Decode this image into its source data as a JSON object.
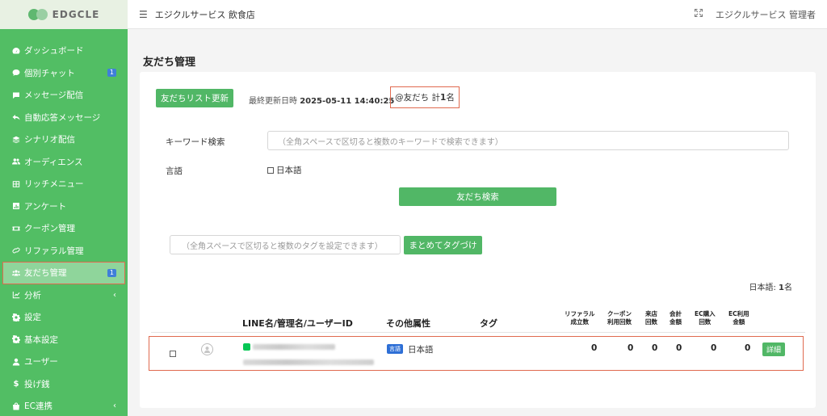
{
  "brand": {
    "name": "EDGCLE"
  },
  "header": {
    "title": "エジクルサービス 飲食店",
    "user": "エジクルサービス 管理者"
  },
  "sidebar": {
    "items": [
      {
        "label": "ダッシュボード",
        "icon": "dashboard-icon"
      },
      {
        "label": "個別チャット",
        "icon": "chat-icon",
        "badge": "1"
      },
      {
        "label": "メッセージ配信",
        "icon": "message-icon"
      },
      {
        "label": "自動応答メッセージ",
        "icon": "reply-icon"
      },
      {
        "label": "シナリオ配信",
        "icon": "layers-icon"
      },
      {
        "label": "オーディエンス",
        "icon": "users-icon"
      },
      {
        "label": "リッチメニュー",
        "icon": "grid-icon"
      },
      {
        "label": "アンケート",
        "icon": "survey-icon"
      },
      {
        "label": "クーポン管理",
        "icon": "ticket-icon"
      },
      {
        "label": "リファラル管理",
        "icon": "link-icon"
      },
      {
        "label": "友だち管理",
        "icon": "friends-icon",
        "badge": "1",
        "active": true
      },
      {
        "label": "分析",
        "icon": "chart-icon",
        "chevron": "‹"
      },
      {
        "label": "設定",
        "icon": "gear-icon"
      },
      {
        "label": "基本設定",
        "icon": "gear-icon"
      },
      {
        "label": "ユーザー",
        "icon": "user-icon"
      },
      {
        "label": "投げ銭",
        "icon": "dollar-icon"
      },
      {
        "label": "EC連携",
        "icon": "bag-icon",
        "chevron": "‹"
      }
    ]
  },
  "page": {
    "title": "友だち管理",
    "refresh_button": "友だちリスト更新",
    "last_updated_label": "最終更新日時",
    "last_updated_value": "2025-05-11 14:40:25",
    "friend_count_prefix": "@友だち 計 ",
    "friend_count_value": "1",
    "friend_count_suffix": "名",
    "keyword_label": "キーワード検索",
    "keyword_placeholder": "（全角スペースで区切ると複数のキーワードで検索できます）",
    "language_label": "言語",
    "language_option": "日本語",
    "search_button": "友だち検索",
    "tag_placeholder": "（全角スペースで区切ると複数のタグを設定できます）",
    "tag_button": "まとめてタグづけ",
    "language_stat_prefix": "日本語: ",
    "language_stat_value": "1",
    "language_stat_suffix": "名"
  },
  "table": {
    "headers": {
      "name": "LINE名/管理名/ユーザーID",
      "attrs": "その他属性",
      "tag": "タグ",
      "referral": [
        "リファラル",
        "成立数"
      ],
      "coupon": [
        "クーポン",
        "利用回数"
      ],
      "visits": [
        "来店",
        "回数"
      ],
      "amount": [
        "会計",
        "金額"
      ],
      "ec_count": [
        "EC購入",
        "回数"
      ],
      "ec_amount": [
        "EC利用",
        "金額"
      ]
    },
    "rows": [
      {
        "language_badge": "言語",
        "language": "日本語",
        "referral": "0",
        "coupon": "0",
        "visits": "0",
        "amount": "0",
        "ec_count": "0",
        "ec_amount": "0",
        "detail_button": "詳細"
      }
    ]
  },
  "colors": {
    "sidebar": "#52be64",
    "accent": "#51b766",
    "highlight": "#e06a4f",
    "badge": "#3f7fd9"
  }
}
